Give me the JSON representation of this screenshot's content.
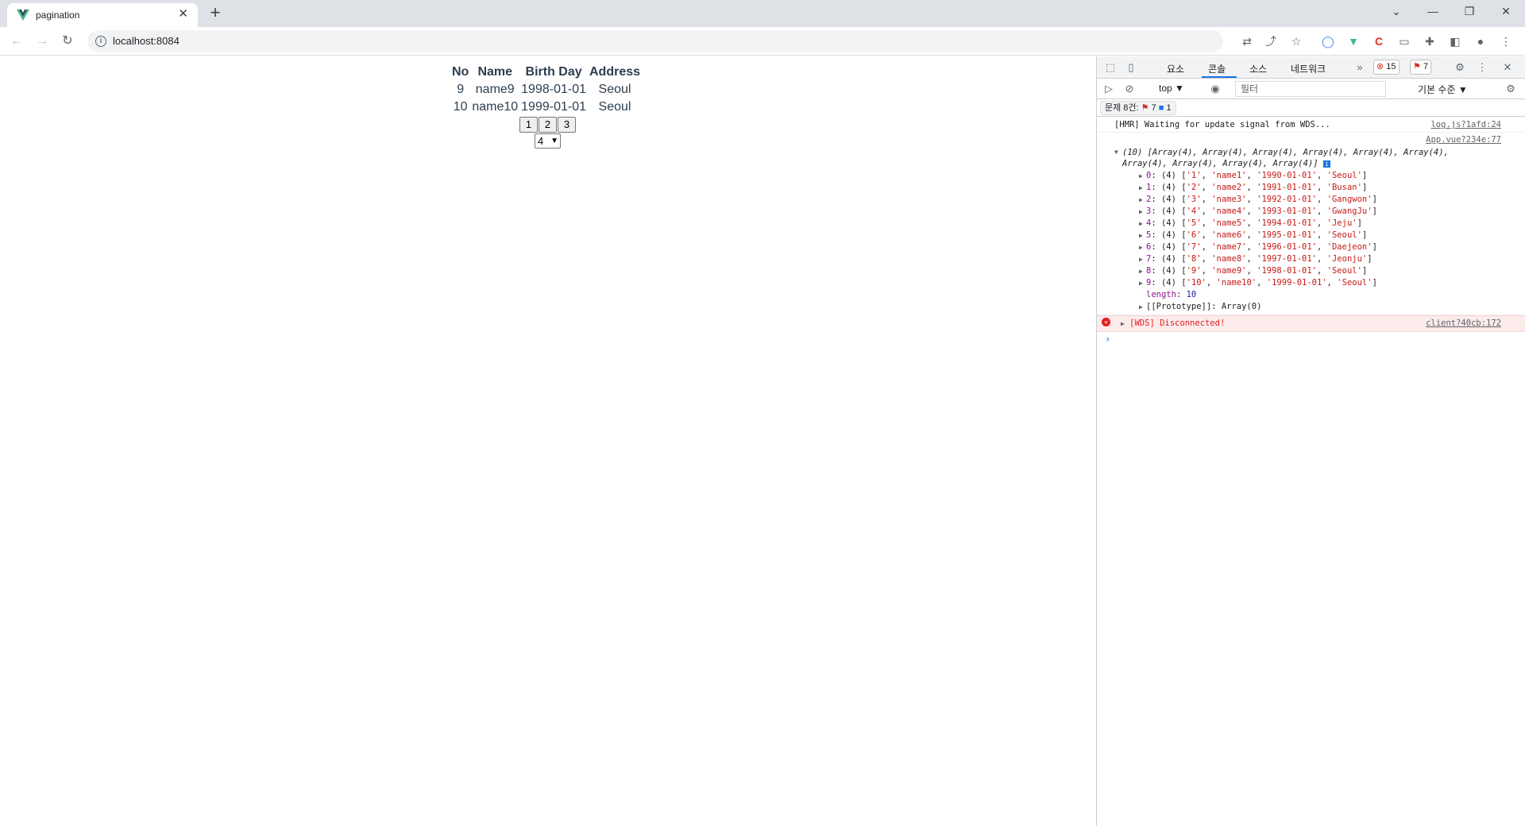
{
  "browser": {
    "tab_title": "pagination",
    "url": "localhost:8084"
  },
  "table": {
    "headers": [
      "No",
      "Name",
      "Birth Day",
      "Address"
    ],
    "rows": [
      [
        "9",
        "name9",
        "1998-01-01",
        "Seoul"
      ],
      [
        "10",
        "name10",
        "1999-01-01",
        "Seoul"
      ]
    ]
  },
  "pagination": {
    "pages": [
      "1",
      "2",
      "3"
    ],
    "page_size": "4"
  },
  "devtools": {
    "tabs": [
      "요소",
      "콘솔",
      "소스",
      "네트워크"
    ],
    "error_count": "15",
    "warning_count": "7",
    "context": "top",
    "filter_placeholder": "필터",
    "levels": "기본 수준",
    "issues_label": "문제 8건:",
    "issues_errors": "7",
    "issues_info": "1",
    "hmr_message": "[HMR] Waiting for update signal from WDS...",
    "hmr_source": "log.js?1afd:24",
    "app_source": "App.vue?234e:77",
    "array_summary_1": "(10) [Array(4), Array(4), Array(4), Array(4), Array(4), Array(4),",
    "array_summary_2": "Array(4), Array(4), Array(4), Array(4)]",
    "entries": [
      {
        "idx": "0",
        "vals": [
          "'1'",
          "'name1'",
          "'1990-01-01'",
          "'Seoul'"
        ]
      },
      {
        "idx": "1",
        "vals": [
          "'2'",
          "'name2'",
          "'1991-01-01'",
          "'Busan'"
        ]
      },
      {
        "idx": "2",
        "vals": [
          "'3'",
          "'name3'",
          "'1992-01-01'",
          "'Gangwon'"
        ]
      },
      {
        "idx": "3",
        "vals": [
          "'4'",
          "'name4'",
          "'1993-01-01'",
          "'GwangJu'"
        ]
      },
      {
        "idx": "4",
        "vals": [
          "'5'",
          "'name5'",
          "'1994-01-01'",
          "'Jeju'"
        ]
      },
      {
        "idx": "5",
        "vals": [
          "'6'",
          "'name6'",
          "'1995-01-01'",
          "'Seoul'"
        ]
      },
      {
        "idx": "6",
        "vals": [
          "'7'",
          "'name7'",
          "'1996-01-01'",
          "'Daejeon'"
        ]
      },
      {
        "idx": "7",
        "vals": [
          "'8'",
          "'name8'",
          "'1997-01-01'",
          "'Jeonju'"
        ]
      },
      {
        "idx": "8",
        "vals": [
          "'9'",
          "'name9'",
          "'1998-01-01'",
          "'Seoul'"
        ]
      },
      {
        "idx": "9",
        "vals": [
          "'10'",
          "'name10'",
          "'1999-01-01'",
          "'Seoul'"
        ]
      }
    ],
    "length_label": "length",
    "length_value": "10",
    "prototype_label": "[[Prototype]]: Array(0)",
    "wds_message": "[WDS] Disconnected!",
    "wds_source": "client?40cb:172"
  }
}
